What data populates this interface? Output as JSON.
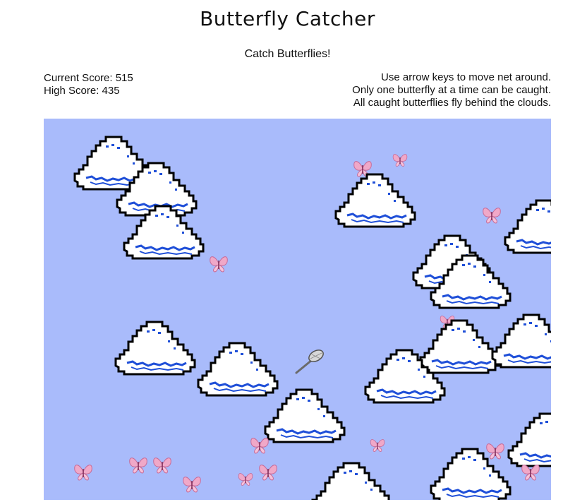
{
  "title": "Butterfly Catcher",
  "subtitle": "Catch Butterflies!",
  "scores": {
    "current_label": "Current Score: 515",
    "high_label": "High Score: 435"
  },
  "instructions": [
    "Use arrow keys to move net around.",
    "Only one butterfly at a time can be caught.",
    "All caught butterflies fly behind the clouds."
  ],
  "colors": {
    "sky": "#a9bbfb",
    "cloud": "#ffffff",
    "cloud_shade": "#1f4fd8",
    "outline": "#000000",
    "butterfly": "#f0a8c8",
    "butterfly_dark": "#b04080"
  },
  "icons": {
    "player": "net-icon",
    "enemy": "butterfly-icon",
    "obstacle": "cloud-icon"
  }
}
